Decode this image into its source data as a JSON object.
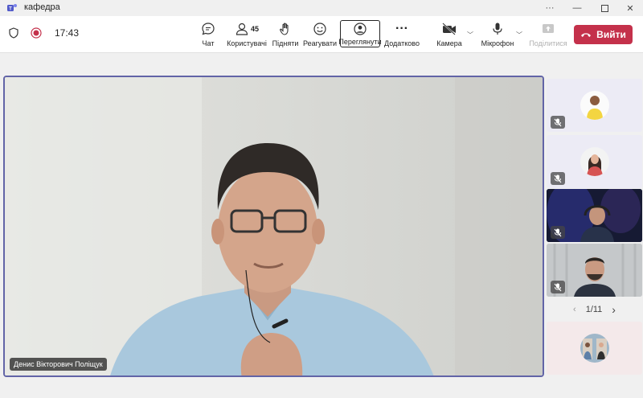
{
  "window": {
    "title": "кафедра",
    "controls": [
      "more-icon",
      "minimize-icon",
      "maximize-icon",
      "close-icon"
    ]
  },
  "toolbar": {
    "time": "17:43",
    "chat_label": "Чат",
    "people_label": "Користувачі",
    "people_count": "45",
    "raise_label": "Підняти",
    "react_label": "Реагувати",
    "view_label": "Переглянути",
    "more_label": "Додатково",
    "camera_label": "Камера",
    "mic_label": "Мікрофон",
    "share_label": "Поділитися",
    "leave_label": "Вийти",
    "leave_color": "#c4314b",
    "accent_color": "#6264a7"
  },
  "stage": {
    "presenter_name": "Денис Вікторович Поліщук"
  },
  "sidebar": {
    "pager": "1/11",
    "thumbnails": [
      {
        "bg": "#ecebf5",
        "muted": true
      },
      {
        "bg": "#ecebf5",
        "muted": true
      },
      {
        "bg": "#1b1f3a",
        "muted": true
      },
      {
        "bg": "#bfc3c6",
        "muted": true
      },
      {
        "bg": "#f4e9ea",
        "muted": false
      }
    ]
  }
}
